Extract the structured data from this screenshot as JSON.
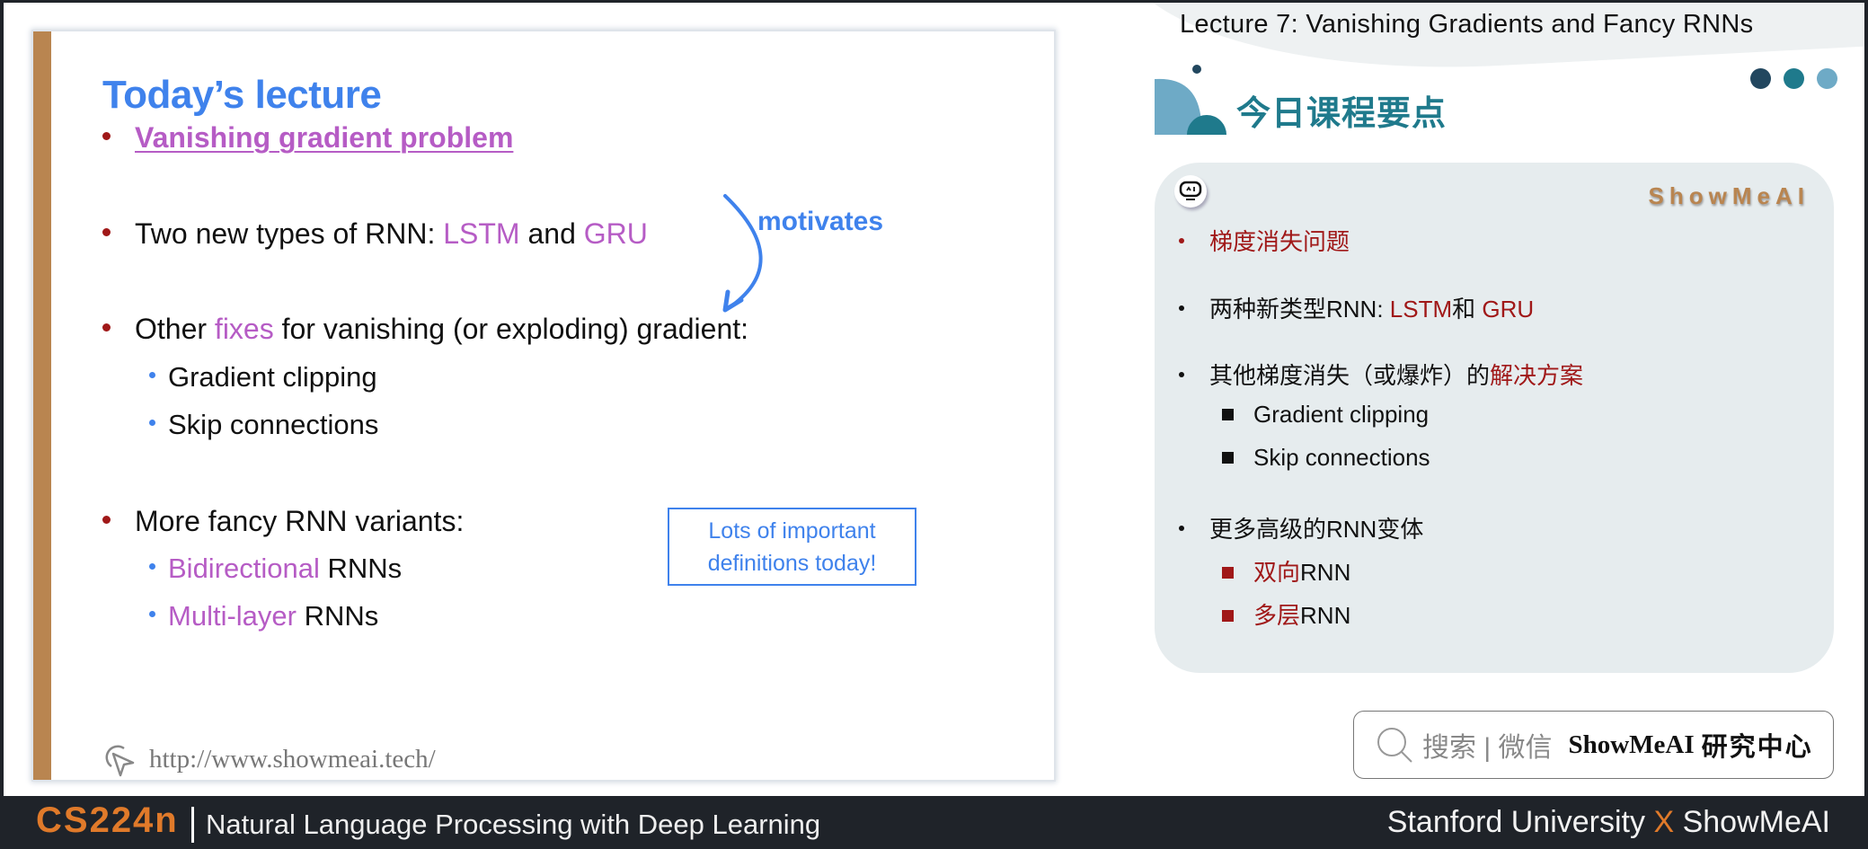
{
  "slide": {
    "title": "Today’s lecture",
    "bullets": [
      {
        "text": "Vanishing gradient problem"
      },
      {
        "prefix": "Two new types of RNN: ",
        "h1": "LSTM",
        "mid": " and ",
        "h2": "GRU"
      },
      {
        "prefix": "Other ",
        "h1": "fixes",
        "suffix": " for vanishing (or exploding) gradient:",
        "subs": [
          "Gradient clipping",
          "Skip connections"
        ]
      },
      {
        "text": "More fancy RNN variants:",
        "subs": [
          {
            "h": "Bidirectional",
            "rest": " RNNs"
          },
          {
            "h": "Multi-layer",
            "rest": " RNNs"
          }
        ]
      }
    ],
    "arrow_label": "motivates",
    "note_line1": "Lots of important",
    "note_line2": "definitions today!",
    "url": "http://www.showmeai.tech/"
  },
  "panel": {
    "lecture_title": "Lecture 7:  Vanishing Gradients and Fancy RNNs",
    "section_title": "今日课程要点",
    "brand_tag": "ShowMeAI",
    "items": [
      {
        "text": "梯度消失问题"
      },
      {
        "prefix": "两种新类型RNN: ",
        "h1": "LSTM",
        "mid": "和 ",
        "h2": "GRU"
      },
      {
        "prefix": "其他梯度消失（或爆炸）的",
        "h1": "解决方案",
        "subs": [
          "Gradient clipping",
          "Skip connections"
        ]
      },
      {
        "text": "更多高级的RNN变体",
        "subs": [
          {
            "h": "双向",
            "rest": "RNN"
          },
          {
            "h": "多层",
            "rest": "RNN"
          }
        ]
      }
    ]
  },
  "search": {
    "hint": "搜索 | 微信",
    "brand": "ShowMeAI",
    "brand_cn": "研究中心"
  },
  "footer": {
    "course_code": "CS224n",
    "course_name": "Natural Language Processing with Deep Learning",
    "right_a": "Stanford University ",
    "right_x": "X",
    "right_b": " ShowMeAI"
  },
  "colors": {
    "accent_blue": "#3f82ec",
    "highlight_purple": "#b65cc5",
    "bullet_red": "#a01818",
    "brand_orange": "#e07a2a",
    "teal": "#1f7a8c",
    "dots": [
      "#22475f",
      "#1f7a8c",
      "#6eaac6"
    ]
  }
}
